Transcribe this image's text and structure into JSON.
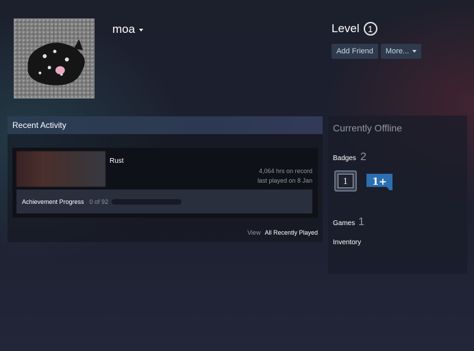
{
  "profile": {
    "persona_name": "moa",
    "level_label": "Level",
    "level_value": "1",
    "add_friend_label": "Add Friend",
    "more_label": "More..."
  },
  "recent_activity": {
    "header": "Recent Activity",
    "game": {
      "name": "Rust",
      "hours": "4,064 hrs on record",
      "last_played": "last played on 8 Jan",
      "achievement_label": "Achievement Progress",
      "achievement_count": "0 of 92",
      "achievement_progress": 0
    },
    "view_label": "View",
    "all_recent_label": "All Recently Played"
  },
  "sidebar": {
    "status": "Currently Offline",
    "badges_label": "Badges",
    "badges_count": "2",
    "badge1_text": "1",
    "badge2_text": "1+",
    "games_label": "Games",
    "games_count": "1",
    "inventory_label": "Inventory"
  },
  "colors": {
    "accent_blue": "#2b6fb0",
    "header_gradient": "#2b3d52",
    "button_bg": "#2f3a4c"
  }
}
